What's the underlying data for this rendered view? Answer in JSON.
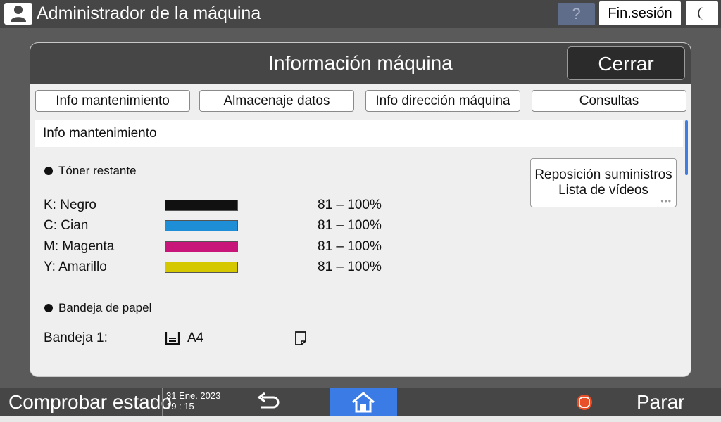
{
  "topbar": {
    "user_icon": "user-icon",
    "title": "Administrador de la máquina",
    "help_label": "?",
    "logout_label": "Fin.sesión",
    "sleep_icon": "moon-icon"
  },
  "panel": {
    "title": "Información máquina",
    "close_label": "Cerrar",
    "tabs": [
      {
        "label": "Info mantenimiento"
      },
      {
        "label": "Almacenaje datos"
      },
      {
        "label": "Info dirección máquina"
      },
      {
        "label": "Consultas"
      }
    ],
    "section_title": "Info mantenimiento",
    "toner_heading": "Tóner restante",
    "toner": [
      {
        "label": "K: Negro",
        "value": "81 – 100%",
        "color": "#111111",
        "level": 100
      },
      {
        "label": "C: Cian",
        "value": "81 – 100%",
        "color": "#1e8fd6",
        "level": 100
      },
      {
        "label": "M: Magenta",
        "value": "81 – 100%",
        "color": "#c8157a",
        "level": 100
      },
      {
        "label": "Y: Amarillo",
        "value": "81 – 100%",
        "color": "#d6c800",
        "level": 100
      }
    ],
    "supply_button": {
      "line1": "Reposición suministros",
      "line2": "Lista de vídeos"
    },
    "paper_heading": "Bandeja de papel",
    "trays": [
      {
        "label": "Bandeja 1:",
        "size": "A4",
        "tray_icon": "paper-tray-icon",
        "orientation_icon": "paper-sheet-icon"
      }
    ]
  },
  "bottombar": {
    "check_status_label": "Comprobar estado",
    "date": "31 Ene. 2023",
    "time": "19 : 15",
    "back_icon": "back-arrow-icon",
    "home_icon": "home-icon",
    "stop_icon": "stop-icon",
    "stop_label": "Parar"
  },
  "colors": {
    "accent_blue": "#3b7be6",
    "header_gray": "#464646"
  }
}
